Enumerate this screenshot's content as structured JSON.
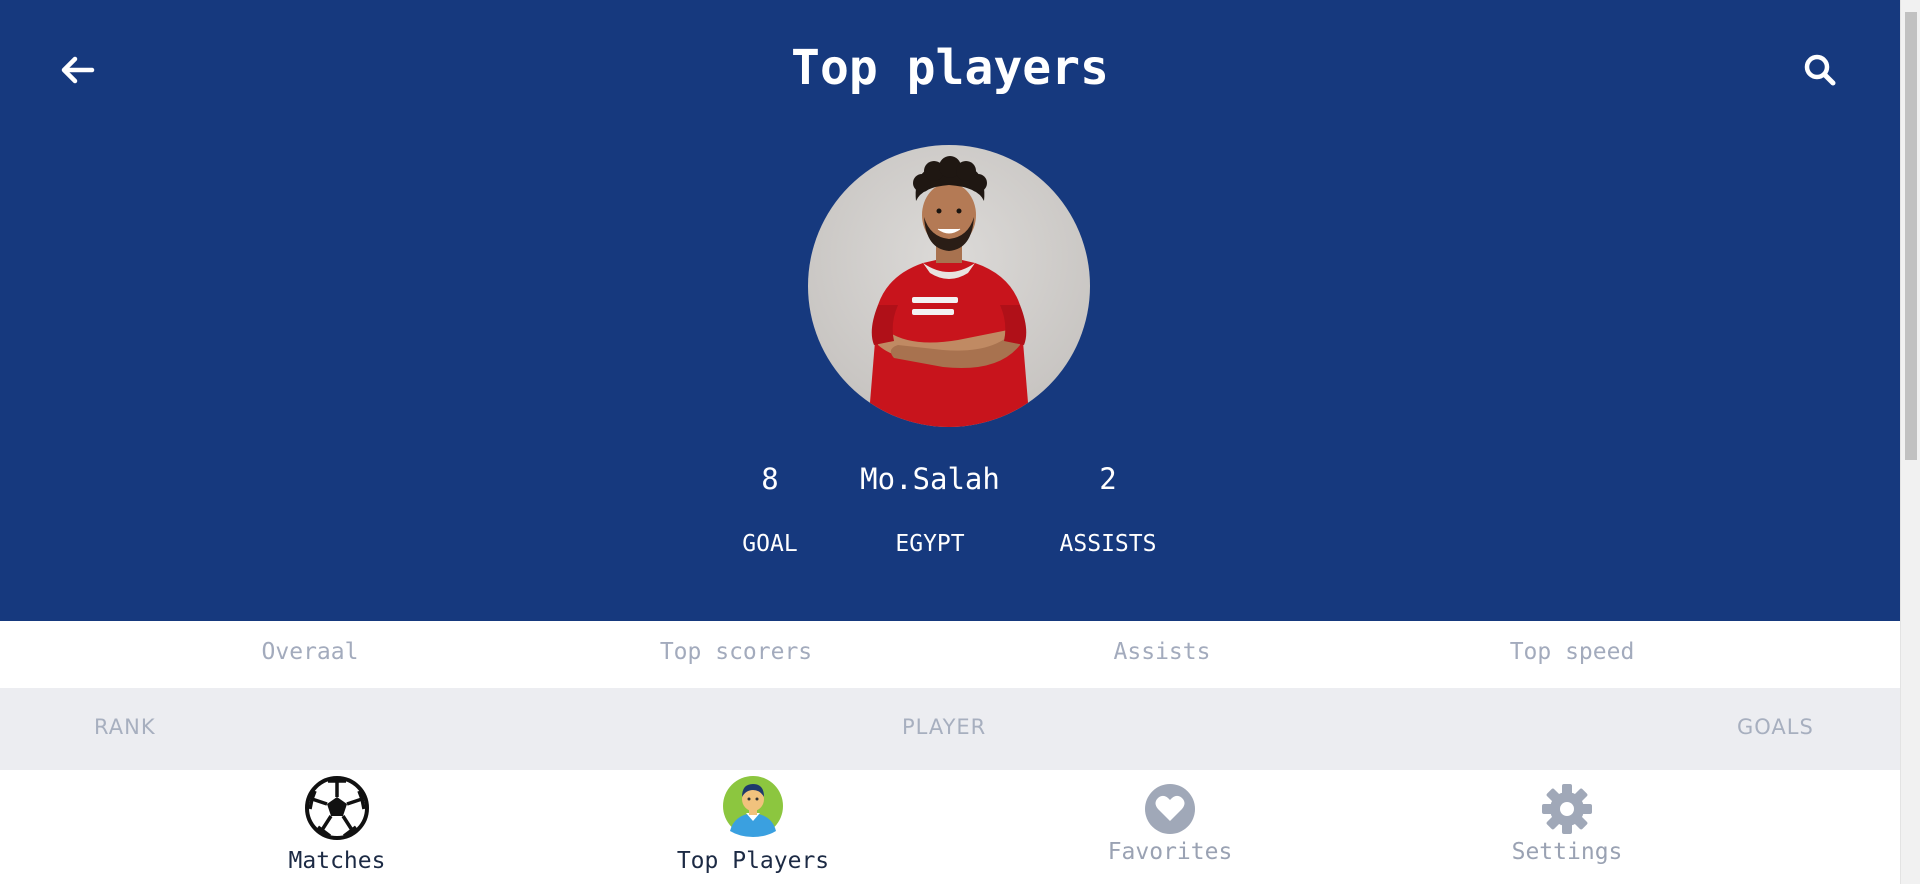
{
  "header": {
    "title": "Top players",
    "bg_color": "#16397e",
    "back_icon": "arrow-left-icon",
    "search_icon": "search-icon"
  },
  "featured_player": {
    "name": "Mo.Salah",
    "country": "EGYPT",
    "goals_value": "8",
    "goals_label": "GOAL",
    "assists_value": "2",
    "assists_label": "ASSISTS"
  },
  "tabs": [
    {
      "label": "Overaal"
    },
    {
      "label": "Top scorers"
    },
    {
      "label": "Assists"
    },
    {
      "label": "Top speed"
    }
  ],
  "table_header": {
    "rank": "RANK",
    "player": "PLAYER",
    "goals": "GOALS"
  },
  "bottom_nav": [
    {
      "label": "Matches",
      "icon": "soccer-ball-icon",
      "active": true
    },
    {
      "label": "Top Players",
      "icon": "player-avatar-icon",
      "active": true
    },
    {
      "label": "Favorites",
      "icon": "heart-icon",
      "active": false
    },
    {
      "label": "Settings",
      "icon": "gear-icon",
      "active": false
    }
  ],
  "colors": {
    "accent": "#16397e",
    "inactive_text": "#a3abbd",
    "active_nav_text": "#1c2a44",
    "inactive_nav_text": "#9aa2b3"
  }
}
